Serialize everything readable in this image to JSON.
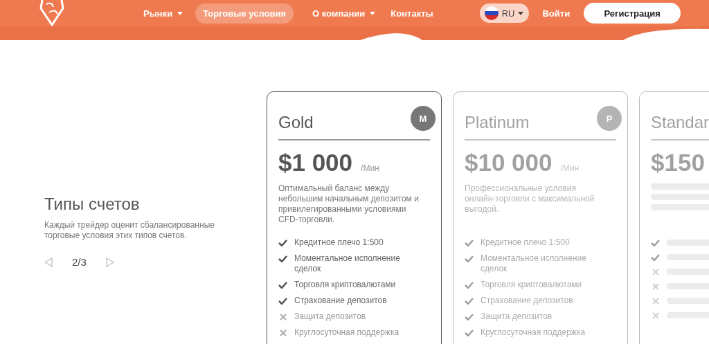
{
  "header": {
    "nav": [
      {
        "label": "Рынки",
        "dropdown": true,
        "selected": false
      },
      {
        "label": "Торговые условия",
        "dropdown": false,
        "selected": true
      },
      {
        "label": "О компании",
        "dropdown": true,
        "selected": false
      },
      {
        "label": "Контакты",
        "dropdown": false,
        "selected": false
      }
    ],
    "language": "RU",
    "login": "Войти",
    "register": "Регистрация"
  },
  "section": {
    "title": "Типы счетов",
    "subtitle": "Каждый трейдер оценит сбалансированные торговые условия этих типов счетов.",
    "pager": "2/3"
  },
  "cards": [
    {
      "name": "Gold",
      "badge": "M",
      "price": "$1 000",
      "per": "/Мин",
      "description": "Оптимальный баланс между небольшим начальным депозитом и привилегированными условиями CFD-торговли.",
      "focused": true,
      "features": [
        {
          "label": "Кредитное плечо 1:500",
          "included": true
        },
        {
          "label": "Моментальное исполнение сделок",
          "included": true
        },
        {
          "label": "Торговля криптовалютами",
          "included": true
        },
        {
          "label": "Страхование депозитов",
          "included": true
        },
        {
          "label": "Защита депозитов",
          "included": false
        },
        {
          "label": "Круглосуточная поддержка",
          "included": false
        }
      ]
    },
    {
      "name": "Platinum",
      "badge": "P",
      "price": "$10 000",
      "per": "/Мин",
      "description": "Профессиональные условия онлайн-торговли с максимальной выгодой.",
      "focused": false,
      "features": [
        {
          "label": "Кредитное плечо 1:500",
          "included": true
        },
        {
          "label": "Моментальное исполнение сделок",
          "included": true
        },
        {
          "label": "Торговля криптовалютами",
          "included": true
        },
        {
          "label": "Страхование депозитов",
          "included": true
        },
        {
          "label": "Защита депозитов",
          "included": true
        },
        {
          "label": "Круглосуточная поддержка",
          "included": true
        }
      ]
    },
    {
      "name": "Standar",
      "price": "$150",
      "focused": false,
      "features": [
        {
          "included": true
        },
        {
          "included": true
        },
        {
          "included": false
        },
        {
          "included": false
        },
        {
          "included": false
        },
        {
          "included": false
        }
      ]
    }
  ]
}
